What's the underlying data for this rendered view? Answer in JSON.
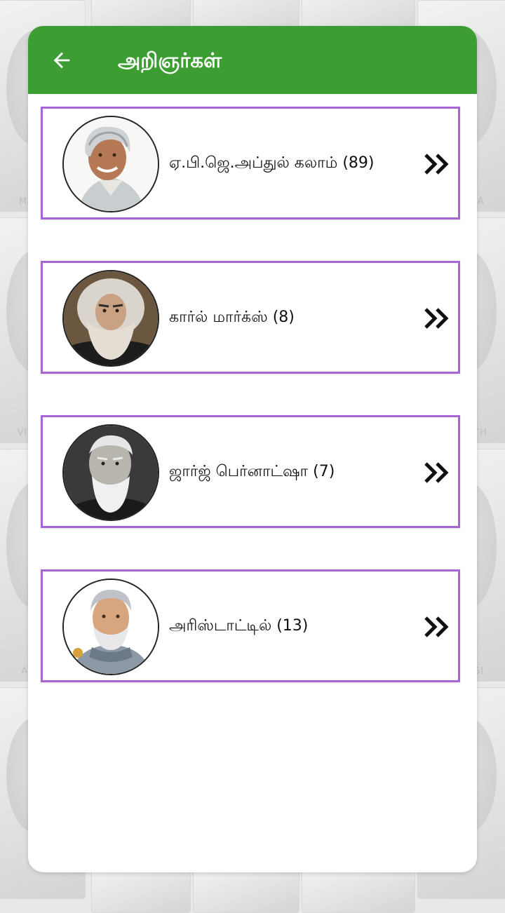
{
  "header": {
    "title": "அறிஞர்கள்",
    "back_icon": "arrow-left-icon"
  },
  "colors": {
    "appbar": "#3c9e32",
    "item_border": "#a766d8",
    "background": "#e9e9e9"
  },
  "background_captions": [
    "MA GA",
    "HARLA",
    "VIVEKA",
    "PANATH",
    "AMBE",
    "GAT SI"
  ],
  "items": [
    {
      "label": "ஏ.பி.ஜெ.அப்துல் கலாம் (89)",
      "avatar": "kalam-avatar",
      "icon": "double-chevron-right-icon"
    },
    {
      "label": "கார்ல் மார்க்ஸ் (8)",
      "avatar": "marx-avatar",
      "icon": "double-chevron-right-icon"
    },
    {
      "label": "ஜார்ஜ் பெர்னாட்ஷா (7)",
      "avatar": "shaw-avatar",
      "icon": "double-chevron-right-icon"
    },
    {
      "label": "அரிஸ்டாட்டில் (13)",
      "avatar": "aristotle-avatar",
      "icon": "double-chevron-right-icon"
    }
  ]
}
